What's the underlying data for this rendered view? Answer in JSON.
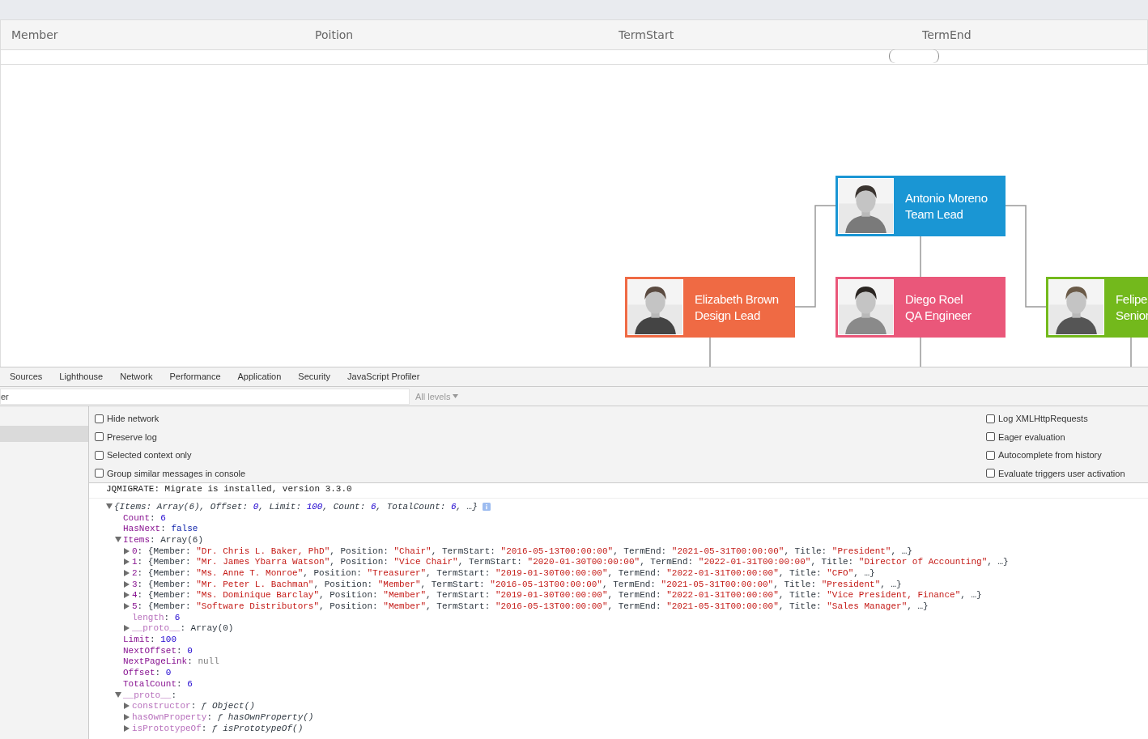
{
  "table": {
    "columns": [
      "Member",
      "Poition",
      "TermStart",
      "TermEnd"
    ]
  },
  "org_chart": {
    "nodes": [
      {
        "name": "Antonio Moreno",
        "role": "Team Lead",
        "color": "#1a96d4"
      },
      {
        "name": "Elizabeth Brown",
        "role": "Design Lead",
        "color": "#ef6a44"
      },
      {
        "name": "Diego Roel",
        "role": "QA Engineer",
        "color": "#ea577a"
      },
      {
        "name": "Felipe",
        "role": "Senior",
        "color": "#73b91c"
      }
    ]
  },
  "devtools": {
    "tabs": [
      {
        "label": "Sources",
        "selected": false
      },
      {
        "label": "Lighthouse",
        "selected": false
      },
      {
        "label": "Network",
        "selected": false
      },
      {
        "label": "Performance",
        "selected": false
      },
      {
        "label": "Application",
        "selected": false
      },
      {
        "label": "Security",
        "selected": false
      },
      {
        "label": "JavaScript Profiler",
        "selected": false
      }
    ],
    "filter": {
      "placeholder": "er"
    },
    "levels": "All levels",
    "settings_left": [
      {
        "label": "Hide network",
        "checked": false
      },
      {
        "label": "Preserve log",
        "checked": false
      },
      {
        "label": "Selected context only",
        "checked": false
      },
      {
        "label": "Group similar messages in console",
        "checked": false
      }
    ],
    "settings_right": [
      {
        "label": "Log XMLHttpRequests",
        "checked": false
      },
      {
        "label": "Eager evaluation",
        "checked": false
      },
      {
        "label": "Autocomplete from history",
        "checked": false
      },
      {
        "label": "Evaluate triggers user activation",
        "checked": false
      }
    ],
    "console": {
      "log_message": "JQMIGRATE: Migrate is installed, version 3.3.0",
      "tree": {
        "kind": "branch",
        "expanded": true,
        "italic": true,
        "info_badge": true,
        "segments": [
          {
            "t": "{Items: Array(6), Offset: ",
            "kind": "plain"
          },
          {
            "t": "0",
            "kind": "number"
          },
          {
            "t": ", Limit: ",
            "kind": "plain"
          },
          {
            "t": "100",
            "kind": "number"
          },
          {
            "t": ", Count: ",
            "kind": "plain"
          },
          {
            "t": "6",
            "kind": "number"
          },
          {
            "t": ", TotalCount: ",
            "kind": "plain"
          },
          {
            "t": "6",
            "kind": "number"
          },
          {
            "t": ", …}",
            "kind": "plain"
          }
        ],
        "children": [
          {
            "kind": "leaf",
            "segments": [
              {
                "t": "Count",
                "kind": "key"
              },
              {
                "t": ": ",
                "kind": "plain"
              },
              {
                "t": "6",
                "kind": "number"
              }
            ]
          },
          {
            "kind": "leaf",
            "segments": [
              {
                "t": "HasNext",
                "kind": "key"
              },
              {
                "t": ": ",
                "kind": "plain"
              },
              {
                "t": "false",
                "kind": "boolean"
              }
            ]
          },
          {
            "kind": "branch",
            "expanded": true,
            "segments": [
              {
                "t": "Items",
                "kind": "key"
              },
              {
                "t": ": Array(6)",
                "kind": "plain"
              }
            ],
            "children": [
              {
                "kind": "branch",
                "expanded": false,
                "segments": [
                  {
                    "t": "0",
                    "kind": "key"
                  },
                  {
                    "t": ": {Member: ",
                    "kind": "plain"
                  },
                  {
                    "t": "\"Dr. Chris L. Baker, PhD\"",
                    "kind": "string"
                  },
                  {
                    "t": ", Position: ",
                    "kind": "plain"
                  },
                  {
                    "t": "\"Chair\"",
                    "kind": "string"
                  },
                  {
                    "t": ", TermStart: ",
                    "kind": "plain"
                  },
                  {
                    "t": "\"2016-05-13T00:00:00\"",
                    "kind": "string"
                  },
                  {
                    "t": ", TermEnd: ",
                    "kind": "plain"
                  },
                  {
                    "t": "\"2021-05-31T00:00:00\"",
                    "kind": "string"
                  },
                  {
                    "t": ", Title: ",
                    "kind": "plain"
                  },
                  {
                    "t": "\"President\"",
                    "kind": "string"
                  },
                  {
                    "t": ", …}",
                    "kind": "plain"
                  }
                ]
              },
              {
                "kind": "branch",
                "expanded": false,
                "segments": [
                  {
                    "t": "1",
                    "kind": "key"
                  },
                  {
                    "t": ": {Member: ",
                    "kind": "plain"
                  },
                  {
                    "t": "\"Mr. James Ybarra Watson\"",
                    "kind": "string"
                  },
                  {
                    "t": ", Position: ",
                    "kind": "plain"
                  },
                  {
                    "t": "\"Vice Chair\"",
                    "kind": "string"
                  },
                  {
                    "t": ", TermStart: ",
                    "kind": "plain"
                  },
                  {
                    "t": "\"2020-01-30T00:00:00\"",
                    "kind": "string"
                  },
                  {
                    "t": ", TermEnd: ",
                    "kind": "plain"
                  },
                  {
                    "t": "\"2022-01-31T00:00:00\"",
                    "kind": "string"
                  },
                  {
                    "t": ", Title: ",
                    "kind": "plain"
                  },
                  {
                    "t": "\"Director of Accounting\"",
                    "kind": "string"
                  },
                  {
                    "t": ", …}",
                    "kind": "plain"
                  }
                ]
              },
              {
                "kind": "branch",
                "expanded": false,
                "segments": [
                  {
                    "t": "2",
                    "kind": "key"
                  },
                  {
                    "t": ": {Member: ",
                    "kind": "plain"
                  },
                  {
                    "t": "\"Ms. Anne T. Monroe\"",
                    "kind": "string"
                  },
                  {
                    "t": ", Position: ",
                    "kind": "plain"
                  },
                  {
                    "t": "\"Treasurer\"",
                    "kind": "string"
                  },
                  {
                    "t": ", TermStart: ",
                    "kind": "plain"
                  },
                  {
                    "t": "\"2019-01-30T00:00:00\"",
                    "kind": "string"
                  },
                  {
                    "t": ", TermEnd: ",
                    "kind": "plain"
                  },
                  {
                    "t": "\"2022-01-31T00:00:00\"",
                    "kind": "string"
                  },
                  {
                    "t": ", Title: ",
                    "kind": "plain"
                  },
                  {
                    "t": "\"CFO\"",
                    "kind": "string"
                  },
                  {
                    "t": ", …}",
                    "kind": "plain"
                  }
                ]
              },
              {
                "kind": "branch",
                "expanded": false,
                "segments": [
                  {
                    "t": "3",
                    "kind": "key"
                  },
                  {
                    "t": ": {Member: ",
                    "kind": "plain"
                  },
                  {
                    "t": "\"Mr. Peter L. Bachman\"",
                    "kind": "string"
                  },
                  {
                    "t": ", Position: ",
                    "kind": "plain"
                  },
                  {
                    "t": "\"Member\"",
                    "kind": "string"
                  },
                  {
                    "t": ", TermStart: ",
                    "kind": "plain"
                  },
                  {
                    "t": "\"2016-05-13T00:00:00\"",
                    "kind": "string"
                  },
                  {
                    "t": ", TermEnd: ",
                    "kind": "plain"
                  },
                  {
                    "t": "\"2021-05-31T00:00:00\"",
                    "kind": "string"
                  },
                  {
                    "t": ", Title: ",
                    "kind": "plain"
                  },
                  {
                    "t": "\"President\"",
                    "kind": "string"
                  },
                  {
                    "t": ", …}",
                    "kind": "plain"
                  }
                ]
              },
              {
                "kind": "branch",
                "expanded": false,
                "segments": [
                  {
                    "t": "4",
                    "kind": "key"
                  },
                  {
                    "t": ": {Member: ",
                    "kind": "plain"
                  },
                  {
                    "t": "\"Ms. Dominique Barclay\"",
                    "kind": "string"
                  },
                  {
                    "t": ", Position: ",
                    "kind": "plain"
                  },
                  {
                    "t": "\"Member\"",
                    "kind": "string"
                  },
                  {
                    "t": ", TermStart: ",
                    "kind": "plain"
                  },
                  {
                    "t": "\"2019-01-30T00:00:00\"",
                    "kind": "string"
                  },
                  {
                    "t": ", TermEnd: ",
                    "kind": "plain"
                  },
                  {
                    "t": "\"2022-01-31T00:00:00\"",
                    "kind": "string"
                  },
                  {
                    "t": ", Title: ",
                    "kind": "plain"
                  },
                  {
                    "t": "\"Vice President, Finance\"",
                    "kind": "string"
                  },
                  {
                    "t": ", …}",
                    "kind": "plain"
                  }
                ]
              },
              {
                "kind": "branch",
                "expanded": false,
                "segments": [
                  {
                    "t": "5",
                    "kind": "key"
                  },
                  {
                    "t": ": {Member: ",
                    "kind": "plain"
                  },
                  {
                    "t": "\"Software Distributors\"",
                    "kind": "string"
                  },
                  {
                    "t": ", Position: ",
                    "kind": "plain"
                  },
                  {
                    "t": "\"Member\"",
                    "kind": "string"
                  },
                  {
                    "t": ", TermStart: ",
                    "kind": "plain"
                  },
                  {
                    "t": "\"2016-05-13T00:00:00\"",
                    "kind": "string"
                  },
                  {
                    "t": ", TermEnd: ",
                    "kind": "plain"
                  },
                  {
                    "t": "\"2021-05-31T00:00:00\"",
                    "kind": "string"
                  },
                  {
                    "t": ", Title: ",
                    "kind": "plain"
                  },
                  {
                    "t": "\"Sales Manager\"",
                    "kind": "string"
                  },
                  {
                    "t": ", …}",
                    "kind": "plain"
                  }
                ]
              },
              {
                "kind": "leaf",
                "segments": [
                  {
                    "t": "length",
                    "kind": "dimkey"
                  },
                  {
                    "t": ": ",
                    "kind": "plain"
                  },
                  {
                    "t": "6",
                    "kind": "number"
                  }
                ]
              },
              {
                "kind": "branch",
                "expanded": false,
                "segments": [
                  {
                    "t": "__proto__",
                    "kind": "dimkey"
                  },
                  {
                    "t": ": Array(0)",
                    "kind": "plain"
                  }
                ]
              }
            ]
          },
          {
            "kind": "leaf",
            "segments": [
              {
                "t": "Limit",
                "kind": "key"
              },
              {
                "t": ": ",
                "kind": "plain"
              },
              {
                "t": "100",
                "kind": "number"
              }
            ]
          },
          {
            "kind": "leaf",
            "segments": [
              {
                "t": "NextOffset",
                "kind": "key"
              },
              {
                "t": ": ",
                "kind": "plain"
              },
              {
                "t": "0",
                "kind": "number"
              }
            ]
          },
          {
            "kind": "leaf",
            "segments": [
              {
                "t": "NextPageLink",
                "kind": "key"
              },
              {
                "t": ": ",
                "kind": "plain"
              },
              {
                "t": "null",
                "kind": "null"
              }
            ]
          },
          {
            "kind": "leaf",
            "segments": [
              {
                "t": "Offset",
                "kind": "key"
              },
              {
                "t": ": ",
                "kind": "plain"
              },
              {
                "t": "0",
                "kind": "number"
              }
            ]
          },
          {
            "kind": "leaf",
            "segments": [
              {
                "t": "TotalCount",
                "kind": "key"
              },
              {
                "t": ": ",
                "kind": "plain"
              },
              {
                "t": "6",
                "kind": "number"
              }
            ]
          },
          {
            "kind": "branch",
            "expanded": true,
            "segments": [
              {
                "t": "__proto__",
                "kind": "dimkey"
              },
              {
                "t": ":",
                "kind": "plain"
              }
            ],
            "children": [
              {
                "kind": "branch",
                "expanded": false,
                "segments": [
                  {
                    "t": "constructor",
                    "kind": "dimkey"
                  },
                  {
                    "t": ": ",
                    "kind": "plain"
                  },
                  {
                    "t": "ƒ Object()",
                    "kind": "function"
                  }
                ]
              },
              {
                "kind": "branch",
                "expanded": false,
                "segments": [
                  {
                    "t": "hasOwnProperty",
                    "kind": "dimkey"
                  },
                  {
                    "t": ": ",
                    "kind": "plain"
                  },
                  {
                    "t": "ƒ hasOwnProperty()",
                    "kind": "function"
                  }
                ]
              },
              {
                "kind": "branch",
                "expanded": false,
                "segments": [
                  {
                    "t": "isPrototypeOf",
                    "kind": "dimkey"
                  },
                  {
                    "t": ": ",
                    "kind": "plain"
                  },
                  {
                    "t": "ƒ isPrototypeOf()",
                    "kind": "function"
                  }
                ]
              }
            ]
          }
        ]
      }
    }
  }
}
